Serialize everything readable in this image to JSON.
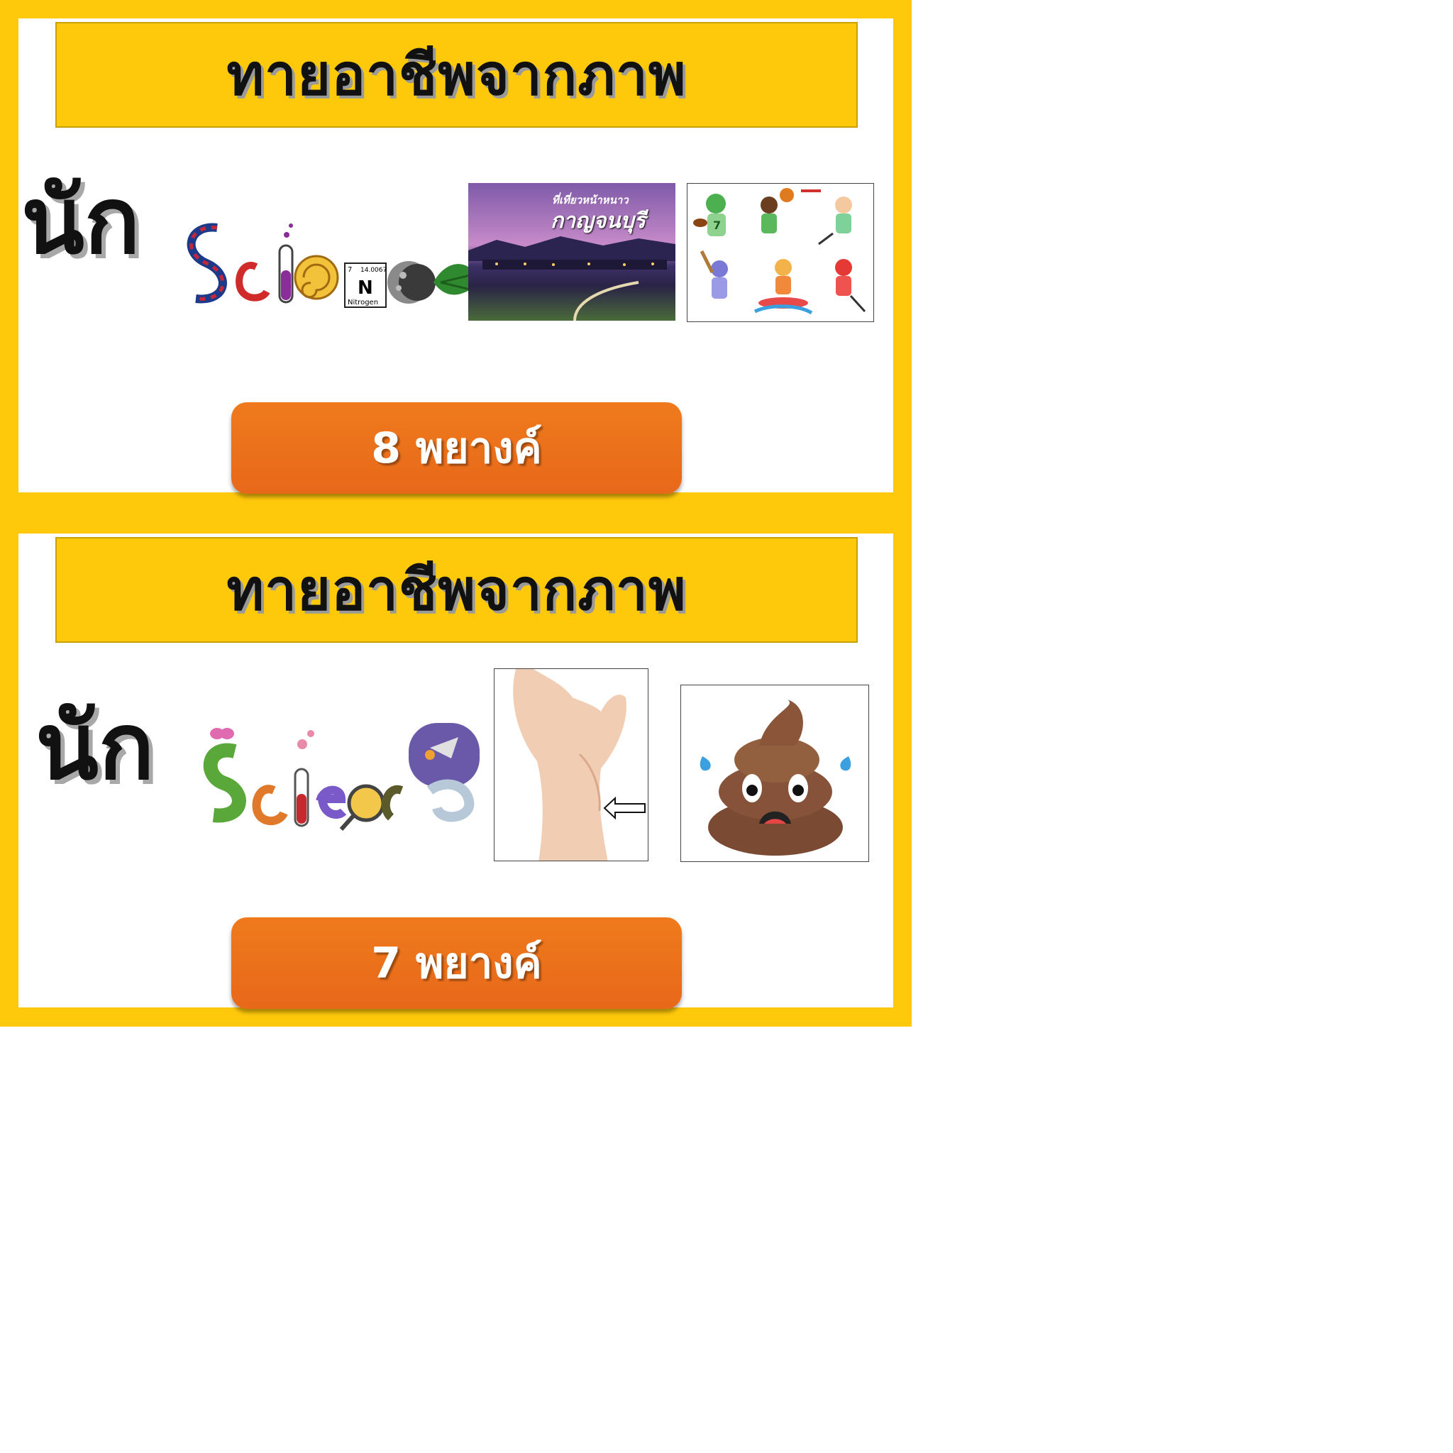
{
  "slides": [
    {
      "title": "ทายอาชีพจากภาพ",
      "prefix": "นัก",
      "science_logo": {
        "letters": [
          "S",
          "c",
          "i",
          "e",
          "N",
          "c",
          "e"
        ],
        "element": {
          "number": "7",
          "mass": "14.0067",
          "symbol": "N",
          "name": "Nitrogen"
        }
      },
      "photo_caption_small": "ที่เที่ยวหน้าหนาว",
      "photo_caption_big": "กาญจนบุรี",
      "sports_jersey": "7",
      "button_label": "8 พยางค์"
    },
    {
      "title": "ทายอาชีพจากภาพ",
      "prefix": "นัก",
      "science_logo": {
        "letters": [
          "S",
          "c",
          "i",
          "e",
          "n",
          "c",
          "e"
        ]
      },
      "button_label": "7 พยางค์"
    }
  ],
  "colors": {
    "frame": "#ffc90b",
    "button": "#e8681a",
    "title_text": "#111111"
  },
  "icons": [
    "dna-icon",
    "test-tube-icon",
    "ammonite-icon",
    "moon-icon",
    "leaf-icon",
    "butterfly-icon",
    "rocket-icon",
    "magnifier-icon",
    "hand-icon",
    "arrow-left-icon",
    "poop-emoji-icon"
  ]
}
